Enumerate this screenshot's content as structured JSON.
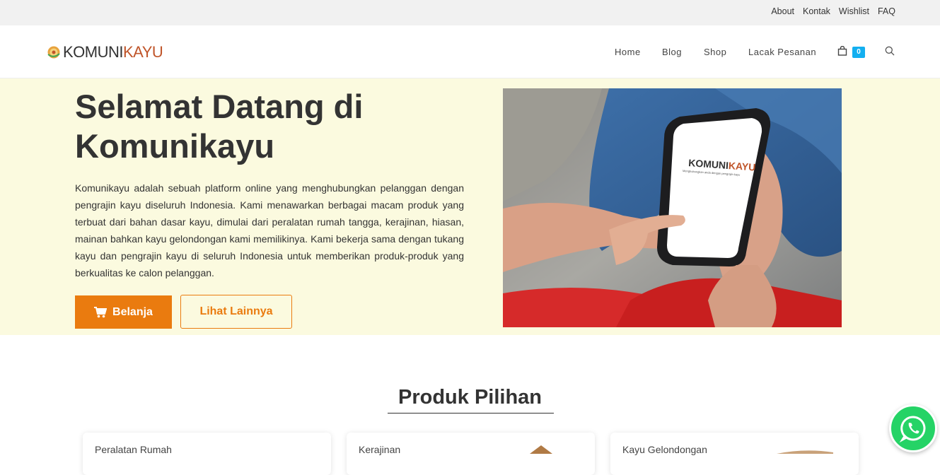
{
  "topbar": {
    "links": [
      "About",
      "Kontak",
      "Wishlist",
      "FAQ"
    ]
  },
  "logo": {
    "part1": "KOMUNI",
    "part2": "KAYU"
  },
  "nav": {
    "items": [
      "Home",
      "Blog",
      "Shop",
      "Lacak Pesanan"
    ],
    "cart_count": "0",
    "cart_icon": "shopping-bag-icon",
    "search_icon": "search-icon"
  },
  "hero": {
    "title": "Selamat Datang di Komunikayu",
    "body": "Komunikayu adalah sebuah platform online yang menghubungkan pelanggan dengan pengrajin kayu diseluruh Indonesia. Kami menawarkan berbagai macam produk yang terbuat dari bahan dasar kayu, dimulai dari peralatan rumah tangga, kerajinan, hiasan, mainan bahkan kayu gelondongan kami memilikinya. Kami bekerja sama dengan tukang kayu dan pengrajin kayu di seluruh Indonesia untuk memberikan produk-produk yang berkualitas ke calon pelanggan.",
    "primary_button": "Belanja",
    "secondary_button": "Lihat Lainnya",
    "image_logo_text_a": "KOMUNI",
    "image_logo_text_b": "KAYU",
    "image_tagline": "Menghubungkan anda dengan pengrajin kayu"
  },
  "products": {
    "title": "Produk Pilihan",
    "cards": [
      "Peralatan Rumah",
      "Kerajinan",
      "Kayu Gelondongan"
    ]
  },
  "colors": {
    "accent": "#ea7b0f",
    "hero_bg": "#fbfadf",
    "badge": "#13aff0",
    "whatsapp": "#25d366"
  }
}
